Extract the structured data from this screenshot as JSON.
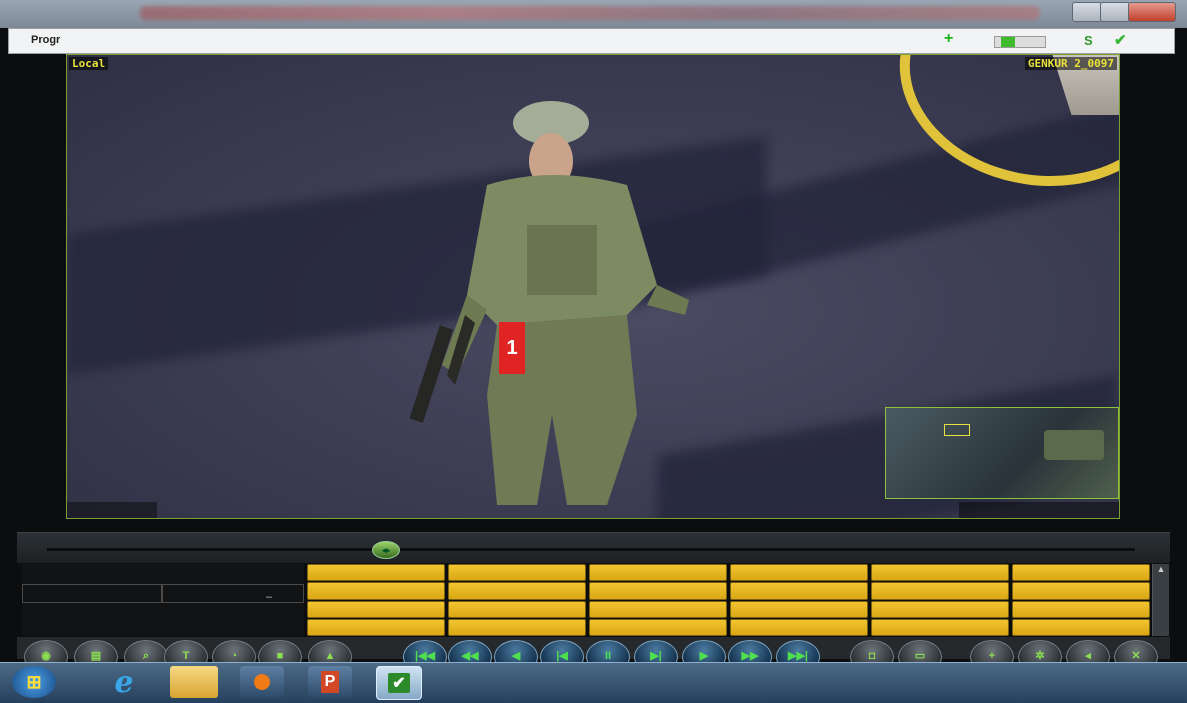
{
  "window": {
    "title_text": "Progr"
  },
  "toolbar": {
    "add_icon": "plus-icon",
    "s_label": "S",
    "check_icon": "check-icon"
  },
  "video": {
    "overlay_left": "Local",
    "overlay_right": "GENKUR 2_0097",
    "marker_label": "1"
  },
  "timeline": {
    "knob_icon": "left-right-arrows-icon",
    "knob_glyph": "◂▸"
  },
  "info_panel": {
    "dash": "–"
  },
  "grid": {
    "rows": 4,
    "cols": 6
  },
  "controls": {
    "left_buttons": [
      "camera-icon",
      "film-icon",
      "zoom-icon",
      "text-icon",
      "speed-icon",
      "screen-icon",
      "eject-icon"
    ],
    "playback_buttons": [
      {
        "name": "first",
        "label": "|◀◀"
      },
      {
        "name": "rewind",
        "label": "◀◀"
      },
      {
        "name": "reverse",
        "label": "◀"
      },
      {
        "name": "step-back",
        "label": "|◀"
      },
      {
        "name": "pause",
        "label": "II"
      },
      {
        "name": "step-forward",
        "label": "▶|"
      },
      {
        "name": "play",
        "label": "▶"
      },
      {
        "name": "fast-forward",
        "label": "▶▶"
      },
      {
        "name": "last",
        "label": "▶▶|"
      }
    ],
    "right_buttons": [
      "snapshot-icon",
      "monitor-icon",
      "zoom-in-icon",
      "settings-icon",
      "volume-icon",
      "close-icon"
    ]
  },
  "taskbar": {
    "start_icon": "windows-start-icon",
    "ie_glyph": "e",
    "folder_icon": "folder-icon",
    "media_icon": "media-player-icon",
    "ppt_label": "P",
    "active_app_icon": "check-app-icon",
    "active_glyph": "✔"
  }
}
